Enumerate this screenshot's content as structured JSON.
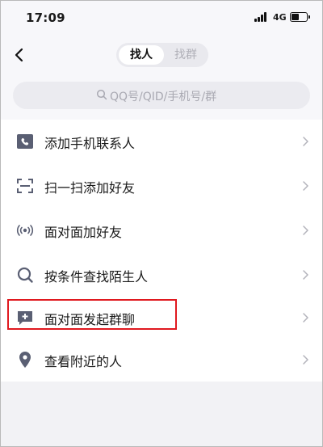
{
  "status_bar": {
    "time": "17:09",
    "network": "4G"
  },
  "header": {
    "tabs": [
      {
        "label": "找人",
        "active": true
      },
      {
        "label": "找群",
        "active": false
      }
    ]
  },
  "search": {
    "placeholder": "QQ号/QID/手机号/群"
  },
  "menu": {
    "items": [
      {
        "label": "添加手机联系人",
        "icon": "phone-icon"
      },
      {
        "label": "扫一扫添加好友",
        "icon": "scan-icon"
      },
      {
        "label": "面对面加好友",
        "icon": "radar-icon"
      },
      {
        "label": "按条件查找陌生人",
        "icon": "search-icon"
      },
      {
        "label": "面对面发起群聊",
        "icon": "chat-add-icon",
        "highlighted": true
      },
      {
        "label": "查看附近的人",
        "icon": "location-pin-icon"
      }
    ]
  },
  "colors": {
    "highlight": "#e0191f",
    "icon": "#5a5f73"
  }
}
